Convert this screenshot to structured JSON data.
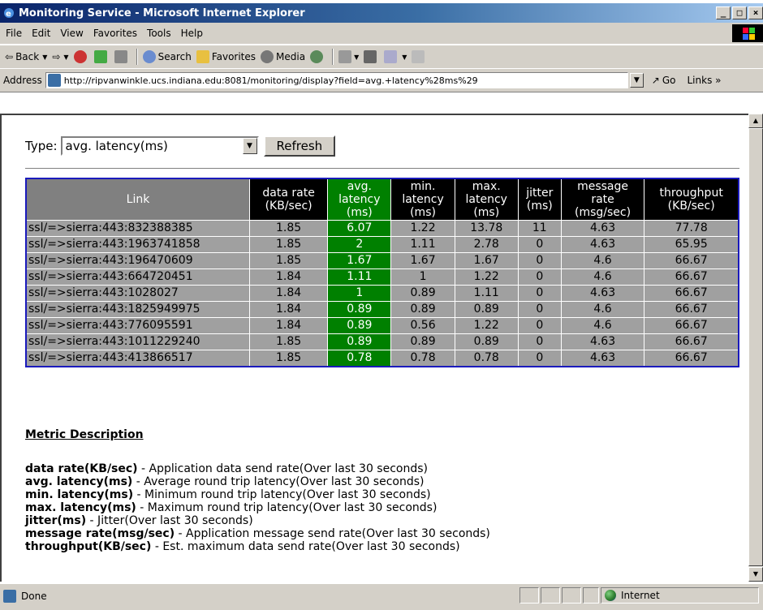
{
  "window": {
    "title": "Monitoring Service - Microsoft Internet Explorer",
    "min": "_",
    "max": "□",
    "close": "×"
  },
  "menu": [
    "File",
    "Edit",
    "View",
    "Favorites",
    "Tools",
    "Help"
  ],
  "toolbar": {
    "back": "Back",
    "search": "Search",
    "favorites": "Favorites",
    "media": "Media"
  },
  "address": {
    "label": "Address",
    "url": "http://ripvanwinkle.ucs.indiana.edu:8081/monitoring/display?field=avg.+latency%28ms%29",
    "go": "Go",
    "links": "Links »"
  },
  "page": {
    "type_label": "Type:",
    "type_value": "avg. latency(ms)",
    "refresh": "Refresh",
    "table": {
      "headers": {
        "link": "Link",
        "data_rate": [
          "data rate",
          "(KB/sec)"
        ],
        "avg_latency": [
          "avg.",
          "latency",
          "(ms)"
        ],
        "min_latency": [
          "min.",
          "latency",
          "(ms)"
        ],
        "max_latency": [
          "max.",
          "latency",
          "(ms)"
        ],
        "jitter": [
          "jitter",
          "(ms)"
        ],
        "message_rate": [
          "message",
          "rate",
          "(msg/sec)"
        ],
        "throughput": [
          "throughput",
          "(KB/sec)"
        ]
      },
      "rows": [
        {
          "link": "ssl/=>sierra:443:832388385",
          "data_rate": "1.85",
          "avg": "6.07",
          "min": "1.22",
          "max": "13.78",
          "jitter": "11",
          "msg": "4.63",
          "thr": "77.78"
        },
        {
          "link": "ssl/=>sierra:443:1963741858",
          "data_rate": "1.85",
          "avg": "2",
          "min": "1.11",
          "max": "2.78",
          "jitter": "0",
          "msg": "4.63",
          "thr": "65.95"
        },
        {
          "link": "ssl/=>sierra:443:196470609",
          "data_rate": "1.85",
          "avg": "1.67",
          "min": "1.67",
          "max": "1.67",
          "jitter": "0",
          "msg": "4.6",
          "thr": "66.67"
        },
        {
          "link": "ssl/=>sierra:443:664720451",
          "data_rate": "1.84",
          "avg": "1.11",
          "min": "1",
          "max": "1.22",
          "jitter": "0",
          "msg": "4.6",
          "thr": "66.67"
        },
        {
          "link": "ssl/=>sierra:443:1028027",
          "data_rate": "1.84",
          "avg": "1",
          "min": "0.89",
          "max": "1.11",
          "jitter": "0",
          "msg": "4.63",
          "thr": "66.67"
        },
        {
          "link": "ssl/=>sierra:443:1825949975",
          "data_rate": "1.84",
          "avg": "0.89",
          "min": "0.89",
          "max": "0.89",
          "jitter": "0",
          "msg": "4.6",
          "thr": "66.67"
        },
        {
          "link": "ssl/=>sierra:443:776095591",
          "data_rate": "1.84",
          "avg": "0.89",
          "min": "0.56",
          "max": "1.22",
          "jitter": "0",
          "msg": "4.6",
          "thr": "66.67"
        },
        {
          "link": "ssl/=>sierra:443:1011229240",
          "data_rate": "1.85",
          "avg": "0.89",
          "min": "0.89",
          "max": "0.89",
          "jitter": "0",
          "msg": "4.63",
          "thr": "66.67"
        },
        {
          "link": "ssl/=>sierra:443:413866517",
          "data_rate": "1.85",
          "avg": "0.78",
          "min": "0.78",
          "max": "0.78",
          "jitter": "0",
          "msg": "4.63",
          "thr": "66.67"
        }
      ]
    },
    "metric_title": "Metric Description",
    "metrics": [
      {
        "name": "data rate(KB/sec)",
        "desc": " - Application data send rate(Over last 30 seconds)"
      },
      {
        "name": "avg. latency(ms)",
        "desc": " - Average round trip latency(Over last 30 seconds)"
      },
      {
        "name": "min. latency(ms)",
        "desc": " - Minimum round trip latency(Over last 30 seconds)"
      },
      {
        "name": "max. latency(ms)",
        "desc": " - Maximum round trip latency(Over last 30 seconds)"
      },
      {
        "name": "jitter(ms)",
        "desc": " - Jitter(Over last 30 seconds)"
      },
      {
        "name": "message rate(msg/sec)",
        "desc": " - Application message send rate(Over last 30 seconds)"
      },
      {
        "name": "throughput(KB/sec)",
        "desc": " - Est. maximum data send rate(Over last 30 seconds)"
      }
    ]
  },
  "status": {
    "left": "Done",
    "zone": "Internet"
  },
  "colors": {
    "selected_column": "#008000",
    "header_bg": "#000000",
    "cell_bg": "#a0a0a0",
    "table_border": "#1a1abc"
  }
}
